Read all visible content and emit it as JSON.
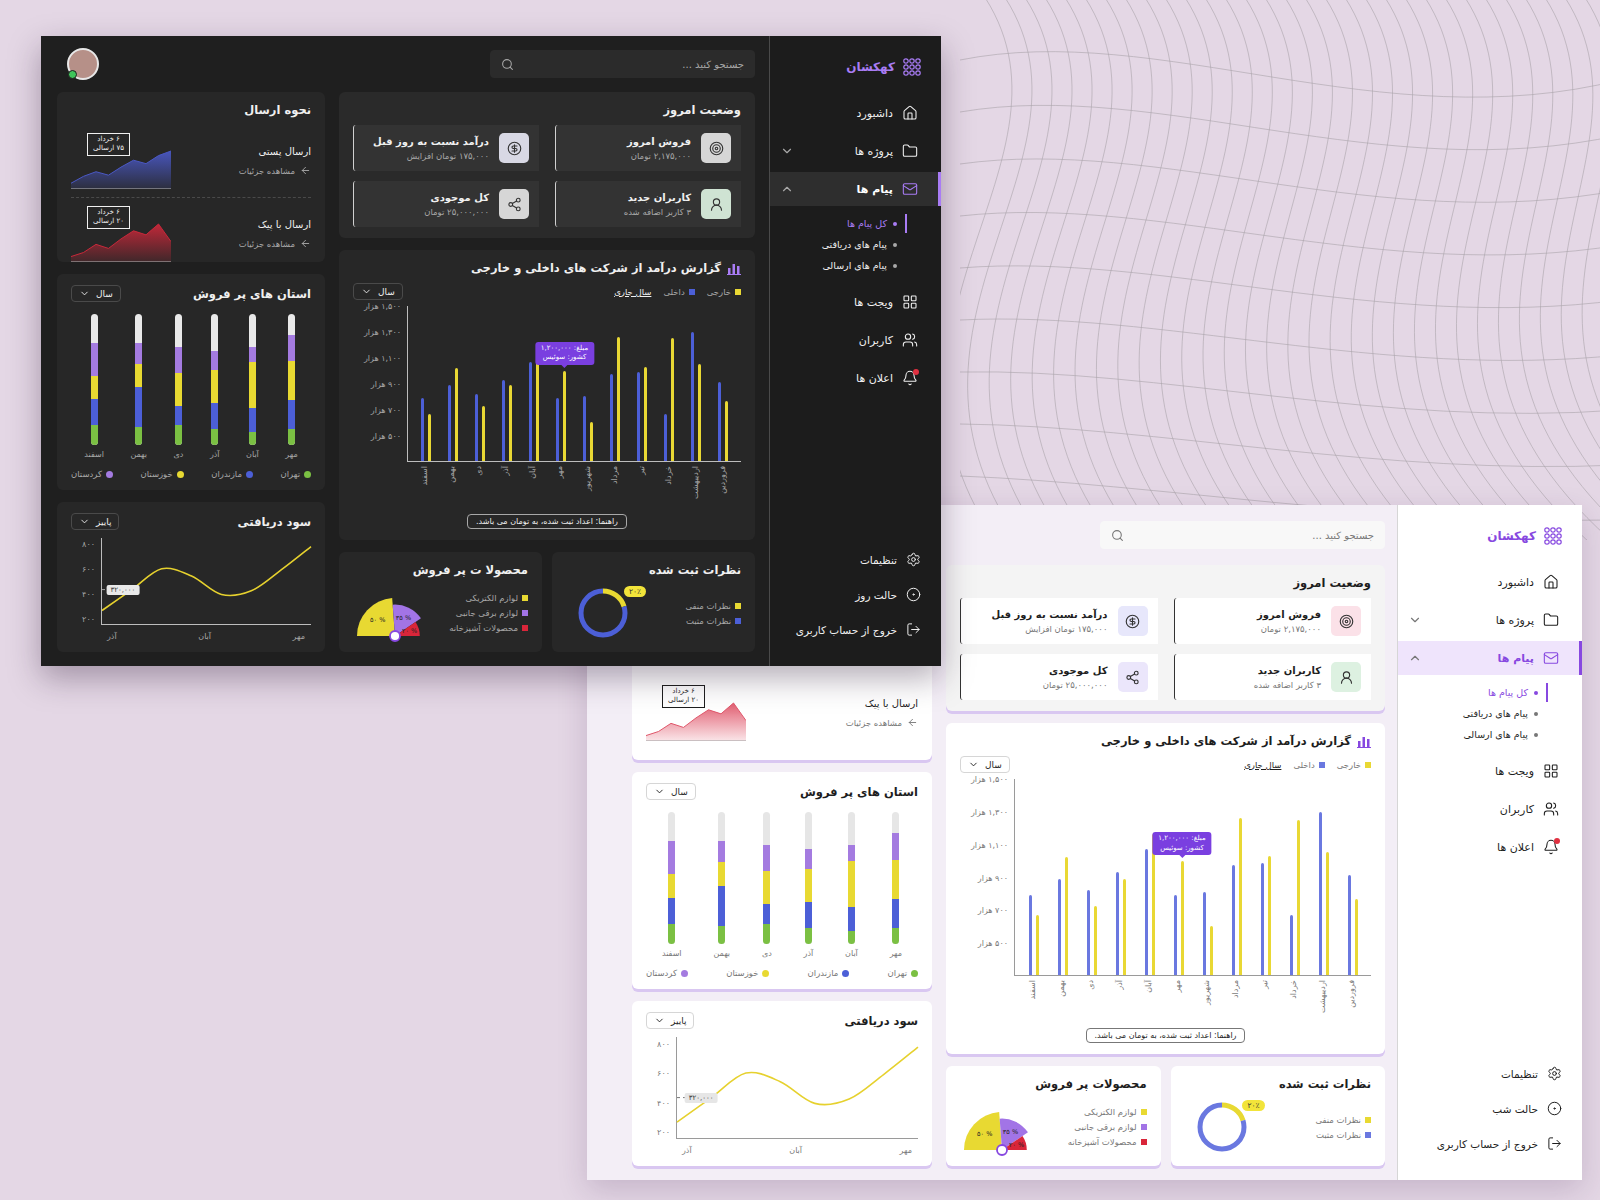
{
  "dark_dashboard": {
    "brand": "کهکشان",
    "search": {
      "placeholder": "جستجو کنید ..."
    },
    "avatar": {
      "online": true
    },
    "nav": [
      {
        "label": "داشبورد",
        "selected": false
      },
      {
        "label": "پروژه ها",
        "selected": false,
        "expandable": true,
        "expanded": false
      },
      {
        "label": "پیام ها",
        "selected": true,
        "expandable": true,
        "expanded": true,
        "children": [
          {
            "label": "کل پیام ها",
            "selected": true
          },
          {
            "label": "پیام های دریافتی",
            "selected": false
          },
          {
            "label": "پیام های ارسالی",
            "selected": false
          }
        ]
      },
      {
        "label": "ویجت ها",
        "selected": false
      },
      {
        "label": "کاربران",
        "selected": false
      },
      {
        "label": "اعلان ها",
        "selected": false,
        "badge": true
      }
    ],
    "footer_nav": [
      {
        "label": "تنظیمات"
      },
      {
        "label": "حالت روز"
      },
      {
        "label": "خروج از حساب کاربری"
      }
    ],
    "status": {
      "title": "وضعیت امروز",
      "cards": [
        {
          "title": "فروش امروز",
          "value": "۲,۱۷۵,۰۰۰ تومان",
          "color": "#d6d6d6"
        },
        {
          "title": "درآمد نسبت به روز قبل",
          "value": "۱۷۵,۰۰۰ تومان افزایش",
          "color": "#d8d8e4"
        },
        {
          "title": "کاربران جدید",
          "value": "۳ کاربر اضافه شده",
          "color": "#cfe3d3"
        },
        {
          "title": "کل موجودی",
          "value": "۲۵,۰۰۰,۰۰۰ تومان",
          "color": "#d6d6d6"
        }
      ]
    },
    "shipping": {
      "title": "نحوه ارسال",
      "items": [
        {
          "label": "ارسال پستی",
          "link": "مشاهده جزئیات",
          "date": "۶ خرداد",
          "count": "۷۵ ارسالی",
          "color": "#4a58c4",
          "values": [
            10,
            22,
            30,
            24,
            38,
            50,
            44,
            58,
            66
          ]
        },
        {
          "label": "ارسال با پیک",
          "link": "مشاهده جزئیات",
          "date": "۶ خرداد",
          "count": "۲۰ ارسالی",
          "color": "#c8283a",
          "values": [
            8,
            14,
            26,
            20,
            34,
            46,
            40,
            56,
            30
          ]
        }
      ]
    },
    "provinces": {
      "title": "استان های پر فروش",
      "period": "سال",
      "months": [
        "مهر",
        "آبان",
        "آذر",
        "دی",
        "بهمن",
        "اسفند"
      ],
      "series": [
        {
          "label": "تهران",
          "color": "#7bc043",
          "values": [
            12,
            10,
            12,
            15,
            14,
            15
          ]
        },
        {
          "label": "مازندران",
          "color": "#4c5fd7",
          "values": [
            22,
            18,
            20,
            15,
            30,
            20
          ]
        },
        {
          "label": "خوزستان",
          "color": "#e8d932",
          "values": [
            30,
            35,
            25,
            25,
            18,
            18
          ]
        },
        {
          "label": "کردستان",
          "color": "#a47be0",
          "values": [
            20,
            12,
            15,
            20,
            16,
            25
          ]
        }
      ]
    },
    "revenue": {
      "title": "گزارش درآمد از شرکت های داخلی و خارجی",
      "period": "سال",
      "filter": "سال جاری",
      "months": [
        "فروردین",
        "اردیبهشت",
        "خرداد",
        "تیر",
        "مرداد",
        "شهریور",
        "مهر",
        "آبان",
        "آذر",
        "دی",
        "بهمن",
        "اسفند"
      ],
      "series": [
        {
          "label": "خارجی",
          "color": "#e9d834",
          "values": [
            764,
            1054,
            1252,
            1029,
            1260,
            600,
            996,
            1161,
            888,
            723,
            1020,
            665
          ]
        },
        {
          "label": "داخلی",
          "color": "#4c5fd7",
          "values": [
            913,
            1300,
            665,
            987,
            971,
            806,
            790,
            1070,
            930,
            822,
            888,
            790
          ]
        }
      ],
      "ticks": [
        {
          "label": "۱,۵۰۰ هزار",
          "value": 1500
        },
        {
          "label": "۱,۳۰۰ هزار",
          "value": 1300
        },
        {
          "label": "۱,۱۰۰ هزار",
          "value": 1100
        },
        {
          "label": "۹۰۰ هزار",
          "value": 900
        },
        {
          "label": "۷۰۰ هزار",
          "value": 700
        },
        {
          "label": "۵۰۰ هزار",
          "value": 500
        }
      ],
      "min": 300,
      "max": 1500,
      "tooltip": {
        "series": 0,
        "month": 6,
        "lines": [
          "مبلغ: ۱,۲۰۰,۰۰۰",
          "کشور: سوئیس"
        ]
      },
      "hint": "راهنما: اعداد ثبت شده، به تومان می باشد."
    },
    "profit": {
      "title": "سود دریافتی",
      "period": "پاییز",
      "ticks": [
        {
          "label": "۸۰۰",
          "value": 800
        },
        {
          "label": "۶۰۰",
          "value": 600
        },
        {
          "label": "۴۰۰",
          "value": 400
        },
        {
          "label": "۲۰۰",
          "value": 200
        }
      ],
      "min": 150,
      "max": 850,
      "months": [
        "مهر",
        "آبان",
        "آذر"
      ],
      "values": [
        260,
        430,
        600,
        540,
        390,
        420,
        590,
        780
      ],
      "marker": {
        "index": 1,
        "label": "۳۲۰,۰۰۰"
      }
    },
    "products": {
      "title": "محصولا ت پر فروش",
      "items": [
        {
          "label": "لوازم الکتریکی",
          "color": "#e8d932",
          "value": 50,
          "percent": "% ۵۰"
        },
        {
          "label": "لوازم برقی جانبی",
          "color": "#a274e6",
          "value": 35,
          "percent": "% ۳۵"
        },
        {
          "label": "محصولات آشپزخانه",
          "color": "#d9263a",
          "value": 20,
          "percent": "% ۲۰"
        }
      ]
    },
    "comments": {
      "title": "نظرات ثبت شده",
      "badge": "۲۰٪",
      "items": [
        {
          "label": "نظرات منفی",
          "color": "#e8d932",
          "level": 0.2
        },
        {
          "label": "نظرات مثبت",
          "color": "#4c5fd7",
          "level": 0.8
        }
      ]
    }
  },
  "light_dashboard": {
    "brand": "کهکشان",
    "search": {
      "placeholder": "جستجو کنید ..."
    },
    "nav": [
      {
        "label": "داشبورد",
        "selected": false
      },
      {
        "label": "پروژه ها",
        "selected": false,
        "expandable": true,
        "expanded": false
      },
      {
        "label": "پیام ها",
        "selected": true,
        "expandable": true,
        "expanded": true,
        "children": [
          {
            "label": "کل پیام ها",
            "selected": true
          },
          {
            "label": "پیام های دریافتی",
            "selected": false
          },
          {
            "label": "پیام های ارسالی",
            "selected": false
          }
        ]
      },
      {
        "label": "ویجت ها",
        "selected": false
      },
      {
        "label": "کاربران",
        "selected": false
      },
      {
        "label": "اعلان ها",
        "selected": false,
        "badge": true
      }
    ],
    "footer_nav": [
      {
        "label": "تنظیمات"
      },
      {
        "label": "حالت شب"
      },
      {
        "label": "خروج از حساب کاربری"
      }
    ],
    "status": {
      "title": "وضعیت امروز",
      "cards": [
        {
          "title": "فروش امروز",
          "value": "۲,۱۷۵,۰۰۰ تومان",
          "color": "#fbe1e8"
        },
        {
          "title": "درآمد نسبت به روز قبل",
          "value": "۱۷۵,۰۰۰ تومان افزایش",
          "color": "#e7e7fb"
        },
        {
          "title": "کاربران جدید",
          "value": "۳ کاربر اضافه شده",
          "color": "#ddf1e1"
        },
        {
          "title": "کل موجودی",
          "value": "۲۵,۰۰۰,۰۰۰ تومان",
          "color": "#ebe6fb"
        }
      ]
    },
    "shipping": {
      "items": [
        {
          "label": "ارسال با پیک",
          "link": "مشاهده جزئیات",
          "date": "۶ خرداد",
          "count": "۲۰ ارسالی",
          "color": "#e0566a",
          "values": [
            8,
            14,
            26,
            20,
            34,
            46,
            40,
            56,
            30
          ]
        }
      ]
    },
    "provinces": {
      "title": "استان های پر فروش",
      "period": "سال",
      "months": [
        "مهر",
        "آبان",
        "آذر",
        "دی",
        "بهمن",
        "اسفند"
      ],
      "series": [
        {
          "label": "تهران",
          "color": "#7bc043",
          "values": [
            12,
            10,
            12,
            15,
            14,
            15
          ]
        },
        {
          "label": "مازندران",
          "color": "#4c5fd7",
          "values": [
            22,
            18,
            20,
            15,
            30,
            20
          ]
        },
        {
          "label": "خوزستان",
          "color": "#e8d932",
          "values": [
            30,
            35,
            25,
            25,
            18,
            18
          ]
        },
        {
          "label": "کردستان",
          "color": "#a47be0",
          "values": [
            20,
            12,
            15,
            20,
            16,
            25
          ]
        }
      ]
    },
    "revenue": {
      "title": "گزارش درآمد از شرکت های داخلی و خارجی",
      "period": "سال",
      "filter": "سال جاری",
      "months": [
        "فروردین",
        "اردیبهشت",
        "خرداد",
        "تیر",
        "مرداد",
        "شهریور",
        "مهر",
        "آبان",
        "آذر",
        "دی",
        "بهمن",
        "اسفند"
      ],
      "series": [
        {
          "label": "خارجی",
          "color": "#e9d834",
          "values": [
            764,
            1054,
            1252,
            1029,
            1260,
            600,
            996,
            1161,
            888,
            723,
            1020,
            665
          ]
        },
        {
          "label": "داخلی",
          "color": "#6a78e0",
          "values": [
            913,
            1300,
            665,
            987,
            971,
            806,
            790,
            1070,
            930,
            822,
            888,
            790
          ]
        }
      ],
      "ticks": [
        {
          "label": "۱,۵۰۰ هزار",
          "value": 1500
        },
        {
          "label": "۱,۳۰۰ هزار",
          "value": 1300
        },
        {
          "label": "۱,۱۰۰ هزار",
          "value": 1100
        },
        {
          "label": "۹۰۰ هزار",
          "value": 900
        },
        {
          "label": "۷۰۰ هزار",
          "value": 700
        },
        {
          "label": "۵۰۰ هزار",
          "value": 500
        }
      ],
      "min": 300,
      "max": 1500,
      "tooltip": {
        "series": 0,
        "month": 6,
        "lines": [
          "مبلغ: ۱,۲۰۰,۰۰۰",
          "کشور: سوئیس"
        ]
      },
      "hint": "راهنما: اعداد ثبت شده، به تومان می باشد."
    },
    "profit": {
      "title": "سود دریافتی",
      "period": "پاییز",
      "ticks": [
        {
          "label": "۸۰۰",
          "value": 800
        },
        {
          "label": "۶۰۰",
          "value": 600
        },
        {
          "label": "۴۰۰",
          "value": 400
        },
        {
          "label": "۲۰۰",
          "value": 200
        }
      ],
      "min": 150,
      "max": 850,
      "months": [
        "مهر",
        "آبان",
        "آذر"
      ],
      "values": [
        260,
        430,
        600,
        540,
        390,
        420,
        590,
        780
      ],
      "marker": {
        "index": 1,
        "label": "۳۲۰,۰۰۰"
      }
    },
    "products": {
      "title": "محصولات پر فروش",
      "items": [
        {
          "label": "لوازم الکتریکی",
          "color": "#e8d932",
          "value": 50,
          "percent": "% ۵۰"
        },
        {
          "label": "لوازم برقی جانبی",
          "color": "#a274e6",
          "value": 35,
          "percent": "% ۳۵"
        },
        {
          "label": "محصولات آشپزخانه",
          "color": "#d9263a",
          "value": 20,
          "percent": "% ۲۰"
        }
      ]
    },
    "comments": {
      "title": "نظرات ثبت شده",
      "badge": "۲۰٪",
      "items": [
        {
          "label": "نظرات منفی",
          "color": "#e8d932",
          "level": 0.2
        },
        {
          "label": "نظرات مثبت",
          "color": "#6a78e0",
          "level": 0.8
        }
      ]
    }
  }
}
